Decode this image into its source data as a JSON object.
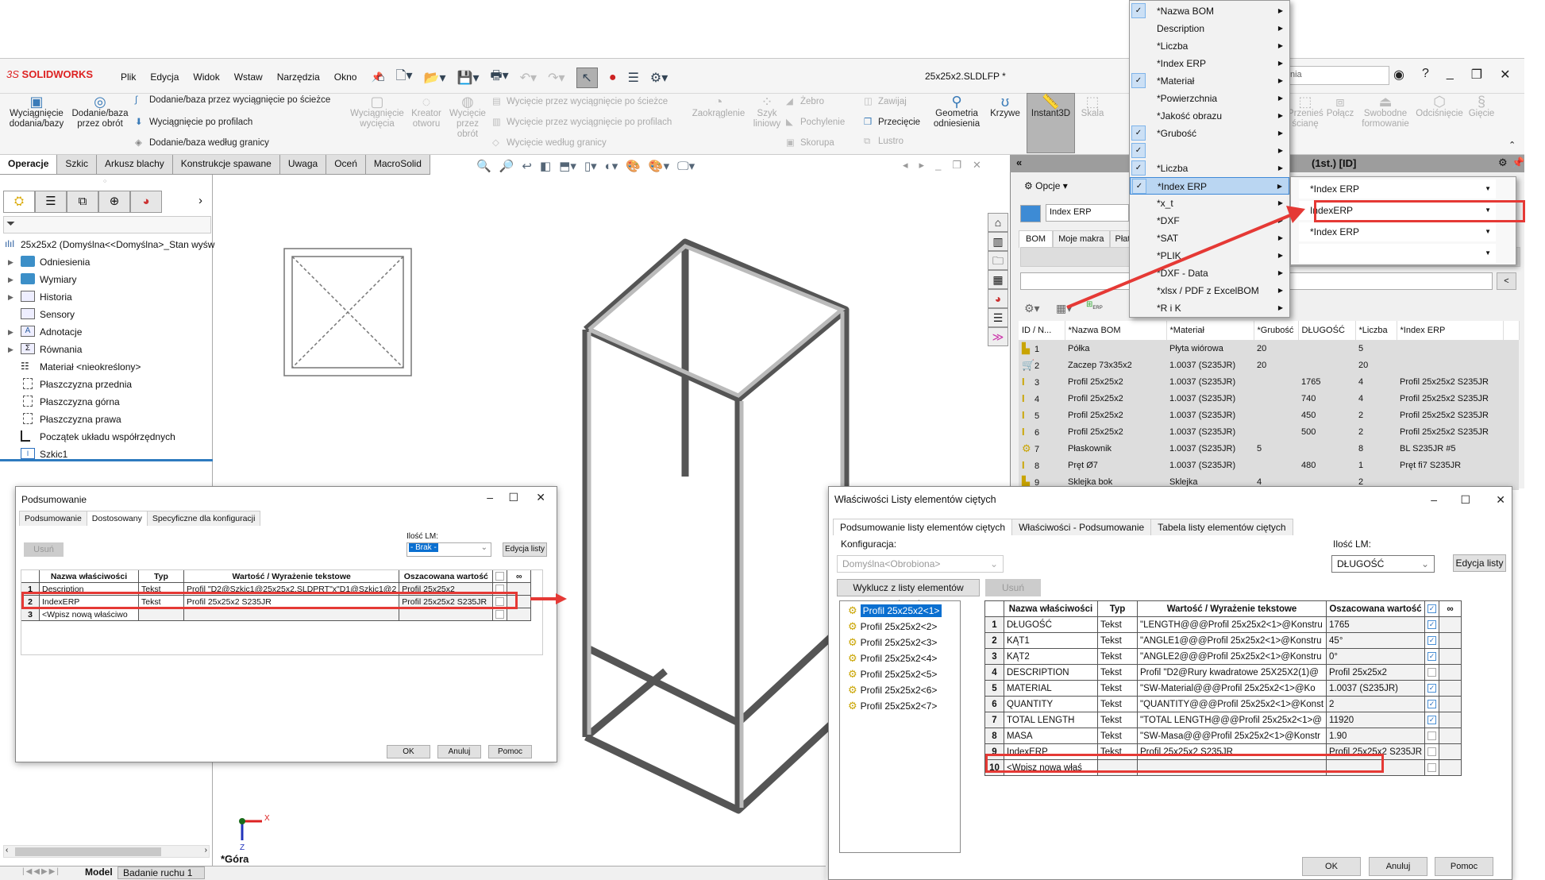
{
  "app": {
    "logo_prefix": "3S",
    "logo_name": "SOLIDWORKS",
    "document_title": "25x25x2.SLDLFP *",
    "search_placeholder": "nia",
    "menus": [
      "Plik",
      "Edycja",
      "Widok",
      "Wstaw",
      "Narzędzia",
      "Okno"
    ]
  },
  "ribbon": {
    "big_buttons": [
      {
        "label": "Wyciągnięcie dodania/bazy",
        "enabled": true
      },
      {
        "label": "Dodanie/baza przez obrót",
        "enabled": true
      },
      {
        "label": "Wyciągnięcie wycięcia",
        "enabled": false
      },
      {
        "label": "Kreator otworu",
        "enabled": false
      },
      {
        "label": "Wycięcie przez obrót",
        "enabled": false
      },
      {
        "label": "Zaokrąglenie",
        "enabled": false
      },
      {
        "label": "Szyk liniowy",
        "enabled": false
      },
      {
        "label": "Geometria odniesienia",
        "enabled": true
      },
      {
        "label": "Krzywe",
        "enabled": true
      },
      {
        "label": "Instant3D",
        "enabled": true,
        "active": true
      },
      {
        "label": "Skala",
        "enabled": false
      },
      {
        "label": "Przenieś ścianę",
        "enabled": false
      },
      {
        "label": "Połącz",
        "enabled": false
      },
      {
        "label": "Swobodne formowanie",
        "enabled": false
      },
      {
        "label": "Odciśnięcie",
        "enabled": false
      },
      {
        "label": "Gięcie",
        "enabled": false
      }
    ],
    "small_rows": [
      {
        "label": "Dodanie/baza przez wyciągnięcie po ścieżce",
        "enabled": true
      },
      {
        "label": "Wyciągnięcie po profilach",
        "enabled": true
      },
      {
        "label": "Dodanie/baza według granicy",
        "enabled": true
      },
      {
        "label": "Wycięcie przez wyciągnięcie po ścieżce",
        "enabled": false
      },
      {
        "label": "Wycięcie przez wyciągnięcie po profilach",
        "enabled": false
      },
      {
        "label": "Wycięcie według granicy",
        "enabled": false
      },
      {
        "label": "Żebro",
        "enabled": false
      },
      {
        "label": "Pochylenie",
        "enabled": false
      },
      {
        "label": "Skorupa",
        "enabled": false
      },
      {
        "label": "Zawijaj",
        "enabled": false
      },
      {
        "label": "Przecięcie",
        "enabled": true
      },
      {
        "label": "Lustro",
        "enabled": false
      }
    ]
  },
  "command_tabs": [
    "Operacje",
    "Szkic",
    "Arkusz blachy",
    "Konstrukcje spawane",
    "Uwaga",
    "Oceń",
    "MacroSolid"
  ],
  "feature_tree": {
    "root": "25x25x2  (Domyślna<<Domyślna>_Stan wyśw",
    "items": [
      {
        "label": "Odniesienia",
        "expandable": true,
        "icon": "folder-icon"
      },
      {
        "label": "Wymiary",
        "expandable": true,
        "icon": "folder-icon"
      },
      {
        "label": "Historia",
        "expandable": true,
        "icon": "history-folder-icon"
      },
      {
        "label": "Sensory",
        "expandable": false,
        "icon": "sensor-folder-icon"
      },
      {
        "label": "Adnotacje",
        "expandable": true,
        "icon": "annotation-folder-icon"
      },
      {
        "label": "Równania",
        "expandable": true,
        "icon": "equation-folder-icon"
      },
      {
        "label": "Materiał <nieokreślony>",
        "expandable": false,
        "icon": "material-icon"
      },
      {
        "label": "Płaszczyzna przednia",
        "expandable": false,
        "icon": "plane-icon"
      },
      {
        "label": "Płaszczyzna górna",
        "expandable": false,
        "icon": "plane-icon"
      },
      {
        "label": "Płaszczyzna prawa",
        "expandable": false,
        "icon": "plane-icon"
      },
      {
        "label": "Początek układu współrzędnych",
        "expandable": false,
        "icon": "origin-icon"
      },
      {
        "label": "Szkic1",
        "expandable": false,
        "icon": "sketch-icon"
      }
    ]
  },
  "viewport": {
    "view_label": "*Góra",
    "axis_x": "X",
    "axis_z": "Z"
  },
  "bottom_tabs": {
    "model": "Model",
    "motion": "Badanie ruchu 1"
  },
  "summary_dialog": {
    "title": "Podsumowanie",
    "tabs": [
      "Podsumowanie",
      "Dostosowany",
      "Specyficzne dla konfiguracji"
    ],
    "active_tab": 1,
    "delete_label": "Usuń",
    "qty_label": "Ilość LM:",
    "qty_value": "- Brak -",
    "edit_list_label": "Edycja listy",
    "columns": [
      "Nazwa właściwości",
      "Typ",
      "Wartość / Wyrażenie tekstowe",
      "Oszacowana wartość"
    ],
    "rows": [
      {
        "n": "1",
        "name": "Description",
        "type": "Tekst",
        "value": "Profil \"D2@Szkic1@25x25x2.SLDPRT\"x\"D1@Szkic1@2",
        "evaluated": "Profil 25x25x2",
        "checked": false
      },
      {
        "n": "2",
        "name": "IndexERP",
        "type": "Tekst",
        "value": "Profil 25x25x2 S235JR",
        "evaluated": "Profil 25x25x2 S235JR",
        "checked": false,
        "highlighted": true
      },
      {
        "n": "3",
        "name": "<Wpisz nową właściwo",
        "type": "",
        "value": "",
        "evaluated": "",
        "checked": false
      }
    ],
    "ok": "OK",
    "cancel": "Anuluj",
    "help": "Pomoc"
  },
  "task_pane": {
    "header": "(1st.) [ID]",
    "options_label": "Opcje",
    "profile_field": "Index ERP",
    "tabs": [
      "BOM",
      "Moje makra",
      "Płatr"
    ],
    "collapse_button": "<",
    "bom_columns": [
      "ID / N...",
      "*Nazwa BOM",
      "*Materiał",
      "*Grubość",
      "DŁUGOŚĆ",
      "*Liczba",
      "*Index ERP"
    ],
    "bom_rows": [
      {
        "id": "1",
        "icon": "plate-icon",
        "name": "Półka",
        "material": "Płyta wiórowa",
        "thickness": "20",
        "length": "",
        "qty": "5",
        "erp": ""
      },
      {
        "id": "2",
        "icon": "purchased-part-icon",
        "name": "Zaczep 73x35x2",
        "material": "1.0037 (S235JR)",
        "thickness": "20",
        "length": "",
        "qty": "20",
        "erp": ""
      },
      {
        "id": "3",
        "icon": "profile-icon",
        "name": "Profil 25x25x2",
        "material": "1.0037 (S235JR)",
        "thickness": "",
        "length": "1765",
        "qty": "4",
        "erp": "Profil 25x25x2 S235JR"
      },
      {
        "id": "4",
        "icon": "profile-icon",
        "name": "Profil 25x25x2",
        "material": "1.0037 (S235JR)",
        "thickness": "",
        "length": "740",
        "qty": "4",
        "erp": "Profil 25x25x2 S235JR"
      },
      {
        "id": "5",
        "icon": "profile-icon",
        "name": "Profil 25x25x2",
        "material": "1.0037 (S235JR)",
        "thickness": "",
        "length": "450",
        "qty": "2",
        "erp": "Profil 25x25x2 S235JR"
      },
      {
        "id": "6",
        "icon": "profile-icon",
        "name": "Profil 25x25x2",
        "material": "1.0037 (S235JR)",
        "thickness": "",
        "length": "500",
        "qty": "2",
        "erp": "Profil 25x25x2 S235JR"
      },
      {
        "id": "7",
        "icon": "sheet-metal-icon",
        "name": "Płaskownik",
        "material": "1.0037 (S235JR)",
        "thickness": "5",
        "length": "",
        "qty": "8",
        "erp": "BL S235JR #5"
      },
      {
        "id": "8",
        "icon": "profile-icon",
        "name": "Pręt Ø7",
        "material": "1.0037 (S235JR)",
        "thickness": "",
        "length": "480",
        "qty": "1",
        "erp": "Pręt fi7 S235JR"
      },
      {
        "id": "9",
        "icon": "plate-icon",
        "name": "Sklejka bok",
        "material": "Sklejka",
        "thickness": "4",
        "length": "",
        "qty": "2",
        "erp": ""
      }
    ]
  },
  "column_menu": {
    "items": [
      {
        "label": "*Nazwa BOM",
        "checked": true
      },
      {
        "label": "Description",
        "checked": false
      },
      {
        "label": "*Liczba",
        "checked": false
      },
      {
        "label": "*Index ERP",
        "checked": false
      },
      {
        "label": "*Materiał",
        "checked": true
      },
      {
        "label": "*Powierzchnia",
        "checked": false
      },
      {
        "label": "*Jakość obrazu",
        "checked": false
      },
      {
        "label": "*Grubość",
        "checked": true
      },
      {
        "label": "",
        "checked": true
      },
      {
        "label": "*Liczba",
        "checked": true
      },
      {
        "label": "*Index ERP",
        "checked": true,
        "hot": true
      },
      {
        "label": "*x_t",
        "checked": false
      },
      {
        "label": "*DXF",
        "checked": false
      },
      {
        "label": "*SAT",
        "checked": false
      },
      {
        "label": "*PLIK",
        "checked": false
      },
      {
        "label": "*DXF - Data",
        "checked": false
      },
      {
        "label": "*xlsx / PDF z ExcelBOM",
        "checked": false
      },
      {
        "label": "*R i K",
        "checked": false
      }
    ],
    "submenu": [
      "*Index ERP",
      "IndexERP",
      "*Index ERP",
      ""
    ],
    "submenu_highlighted": 1
  },
  "cutlist_dialog": {
    "title": "Właściwości Listy elementów ciętych",
    "tabs": [
      "Podsumowanie listy elementów ciętych",
      "Właściwości - Podsumowanie",
      "Tabela listy elementów ciętych"
    ],
    "config_label": "Konfiguracja:",
    "config_value": "Domyślna<Obrobiona>",
    "exclude_label": "Wyklucz z listy elementów ciętych",
    "delete_label": "Usuń",
    "qty_label": "Ilość LM:",
    "qty_value": "DŁUGOŚĆ",
    "edit_list_label": "Edycja listy",
    "items": [
      "Profil 25x25x2<1>",
      "Profil 25x25x2<2>",
      "Profil 25x25x2<3>",
      "Profil 25x25x2<4>",
      "Profil 25x25x2<5>",
      "Profil 25x25x2<6>",
      "Profil 25x25x2<7>"
    ],
    "selected_item": 0,
    "columns": [
      "Nazwa właściwości",
      "Typ",
      "Wartość / Wyrażenie tekstowe",
      "Oszacowana wartość"
    ],
    "rows": [
      {
        "n": "1",
        "name": "DŁUGOŚĆ",
        "type": "Tekst",
        "value": "\"LENGTH@@@Profil 25x25x2<1>@Konstru",
        "evaluated": "1765",
        "checked": true
      },
      {
        "n": "2",
        "name": "KĄT1",
        "type": "Tekst",
        "value": "\"ANGLE1@@@Profil 25x25x2<1>@Konstru",
        "evaluated": "45°",
        "checked": true
      },
      {
        "n": "3",
        "name": "KĄT2",
        "type": "Tekst",
        "value": "\"ANGLE2@@@Profil 25x25x2<1>@Konstru",
        "evaluated": "0°",
        "checked": true
      },
      {
        "n": "4",
        "name": "DESCRIPTION",
        "type": "Tekst",
        "value": "Profil \"D2@Rury kwadratowe 25X25X2(1)@",
        "evaluated": "Profil 25x25x2",
        "checked": false
      },
      {
        "n": "5",
        "name": "MATERIAL",
        "type": "Tekst",
        "value": "\"SW-Material@@@Profil 25x25x2<1>@Ko",
        "evaluated": "1.0037 (S235JR)",
        "checked": true
      },
      {
        "n": "6",
        "name": "QUANTITY",
        "type": "Tekst",
        "value": "\"QUANTITY@@@Profil 25x25x2<1>@Konst",
        "evaluated": "2",
        "checked": true
      },
      {
        "n": "7",
        "name": "TOTAL LENGTH",
        "type": "Tekst",
        "value": "\"TOTAL LENGTH@@@Profil 25x25x2<1>@",
        "evaluated": "11920",
        "checked": true
      },
      {
        "n": "8",
        "name": "MASA",
        "type": "Tekst",
        "value": "\"SW-Masa@@@Profil 25x25x2<1>@Konstr",
        "evaluated": "1.90",
        "checked": false
      },
      {
        "n": "9",
        "name": "IndexERP",
        "type": "Tekst",
        "value": "Profil 25x25x2 S235JR",
        "evaluated": "Profil 25x25x2 S235JR",
        "checked": false,
        "highlighted": true
      },
      {
        "n": "10",
        "name": "<Wpisz nową właś",
        "type": "",
        "value": "",
        "evaluated": "",
        "checked": false
      }
    ],
    "ok": "OK",
    "cancel": "Anuluj",
    "help": "Pomoc"
  },
  "colors": {
    "highlight_red": "#e53935",
    "selection_blue": "#0a6fd0",
    "menu_hot": "#bad6f2",
    "logo_red": "#dd2222"
  }
}
